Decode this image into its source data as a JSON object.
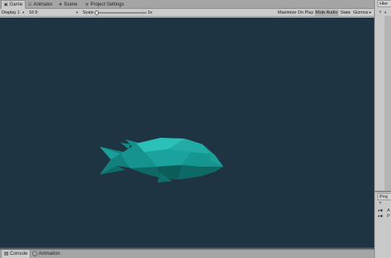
{
  "top_tabs": [
    {
      "label": "Game",
      "icon": "game-icon"
    },
    {
      "label": "Animator",
      "icon": "animator-icon"
    },
    {
      "label": "Scene",
      "icon": "scene-icon"
    },
    {
      "label": "Project Settings",
      "icon": "gear-icon"
    }
  ],
  "toolbar": {
    "display": "Display 1",
    "aspect": "16:9",
    "scale_label": "Scale",
    "scale_value": "1x",
    "scale_level": 0.0,
    "maximize_on_play": "Maximize On Play",
    "mute_audio": "Mute Audio",
    "stats": "Stats",
    "gizmos": "Gizmos"
  },
  "bottom_tabs": [
    {
      "label": "Console",
      "icon": "console-icon"
    },
    {
      "label": "Animation",
      "icon": "animation-icon"
    }
  ],
  "right_panel": {
    "hierarchy_tab": "Hier",
    "add": "+",
    "project_tab": "Proj",
    "project_items": [
      "A",
      "P"
    ]
  },
  "colors": {
    "viewport_bg": "#1f3443",
    "fish_body": "#17938f",
    "fish_light": "#2bc0b8",
    "fish_dark": "#0d6966"
  }
}
